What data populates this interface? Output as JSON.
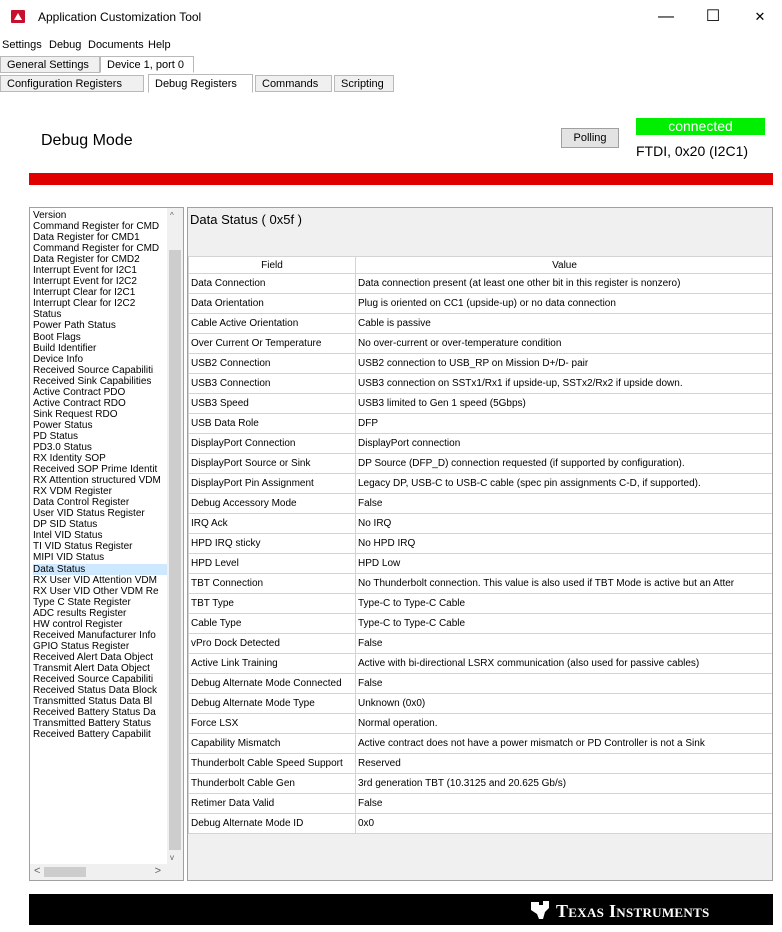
{
  "window": {
    "title": "Application Customization Tool",
    "minimize": "—",
    "maximize": "☐",
    "close": "✕"
  },
  "menu": [
    "Settings",
    "Debug",
    "Documents",
    "Help"
  ],
  "top_tabs": [
    "General Settings",
    "Device 1, port 0"
  ],
  "sub_tabs": [
    "Configuration Registers",
    "Debug Registers",
    "Commands",
    "Scripting"
  ],
  "debug": {
    "title": "Debug Mode",
    "polling_label": "Polling",
    "status": "connected",
    "status_color": "#00ee00",
    "connection": "FTDI, 0x20 (I2C1)",
    "bar_color": "#e00000"
  },
  "sidebar": {
    "items": [
      "Version",
      "Command Register for CMD",
      "Data Register for CMD1",
      "Command Register for CMD",
      "Data Register for CMD2",
      "Interrupt Event for I2C1",
      "Interrupt Event for I2C2",
      "Interrupt Clear for I2C1",
      "Interrupt Clear for I2C2",
      "Status",
      "Power Path Status",
      "Boot Flags",
      "Build Identifier",
      "Device Info",
      "Received Source Capabiliti",
      "Received Sink Capabilities",
      "Active Contract PDO",
      "Active Contract RDO",
      "Sink Request RDO",
      "Power Status",
      "PD Status",
      "PD3.0 Status",
      "RX Identity SOP",
      "Received SOP Prime Identit",
      "RX Attention structured VDM",
      "RX VDM Register",
      "Data Control Register",
      "User VID Status Register",
      "DP SID Status",
      "Intel VID Status",
      "TI VID Status Register",
      "MIPI VID Status",
      "Data Status",
      "RX User VID Attention VDM",
      "RX User VID Other VDM Re",
      "Type C State Register",
      "ADC results Register",
      "HW control Register",
      "Received Manufacturer Info",
      "GPIO Status Register",
      "Received Alert Data Object",
      "Transmit Alert Data Object",
      "Received Source Capabiliti",
      "Received Status Data Block",
      "Transmitted Status Data Bl",
      "Received Battery Status Da",
      "Transmitted Battery Status",
      "Received Battery Capabilit"
    ],
    "selected": "Data Status",
    "up": "^",
    "down": "v",
    "left": "<",
    "right": ">"
  },
  "content": {
    "title": "Data Status  ( 0x5f )",
    "headers": [
      "Field",
      "Value"
    ],
    "rows": [
      [
        "Data Connection",
        "Data connection present (at least one other bit in this register is nonzero)"
      ],
      [
        "Data Orientation",
        "Plug is oriented on CC1 (upside-up) or no data connection"
      ],
      [
        "Cable Active Orientation",
        "Cable is passive"
      ],
      [
        "Over Current Or Temperature",
        "No over-current or over-temperature condition"
      ],
      [
        "USB2 Connection",
        "USB2 connection to USB_RP on Mission D+/D- pair"
      ],
      [
        "USB3 Connection",
        "USB3 connection on SSTx1/Rx1 if upside-up, SSTx2/Rx2 if upside down."
      ],
      [
        "USB3 Speed",
        "USB3 limited to Gen 1 speed (5Gbps)"
      ],
      [
        "USB Data Role",
        "DFP"
      ],
      [
        "DisplayPort Connection",
        "DisplayPort connection"
      ],
      [
        "DisplayPort Source or Sink",
        "DP Source (DFP_D) connection requested (if supported by configuration)."
      ],
      [
        "DisplayPort Pin Assignment",
        "Legacy DP, USB-C to USB-C cable (spec pin assignments C-D, if supported)."
      ],
      [
        "Debug Accessory Mode",
        "False"
      ],
      [
        "IRQ Ack",
        "No IRQ"
      ],
      [
        "HPD IRQ sticky",
        "No HPD IRQ"
      ],
      [
        "HPD Level",
        "HPD Low"
      ],
      [
        "TBT Connection",
        "No Thunderbolt connection. This value is also used if TBT Mode is active but an Atter"
      ],
      [
        "TBT Type",
        "Type-C to Type-C Cable"
      ],
      [
        "Cable Type",
        "Type-C to Type-C Cable"
      ],
      [
        "vPro Dock Detected",
        "False"
      ],
      [
        "Active Link Training",
        "Active with bi-directional LSRX communication (also used for passive cables)"
      ],
      [
        "Debug Alternate Mode Connected",
        "False"
      ],
      [
        "Debug Alternate Mode Type",
        "Unknown (0x0)"
      ],
      [
        "Force LSX",
        "Normal operation."
      ],
      [
        "Capability Mismatch",
        "Active contract does not have a power mismatch or PD Controller is not a Sink"
      ],
      [
        "Thunderbolt Cable Speed Support",
        "Reserved"
      ],
      [
        "Thunderbolt Cable Gen",
        "3rd generation TBT (10.3125 and 20.625 Gb/s)"
      ],
      [
        "Retimer Data Valid",
        "False"
      ],
      [
        "Debug Alternate Mode ID",
        "0x0"
      ]
    ]
  },
  "footer": {
    "brand": "Texas Instruments"
  }
}
